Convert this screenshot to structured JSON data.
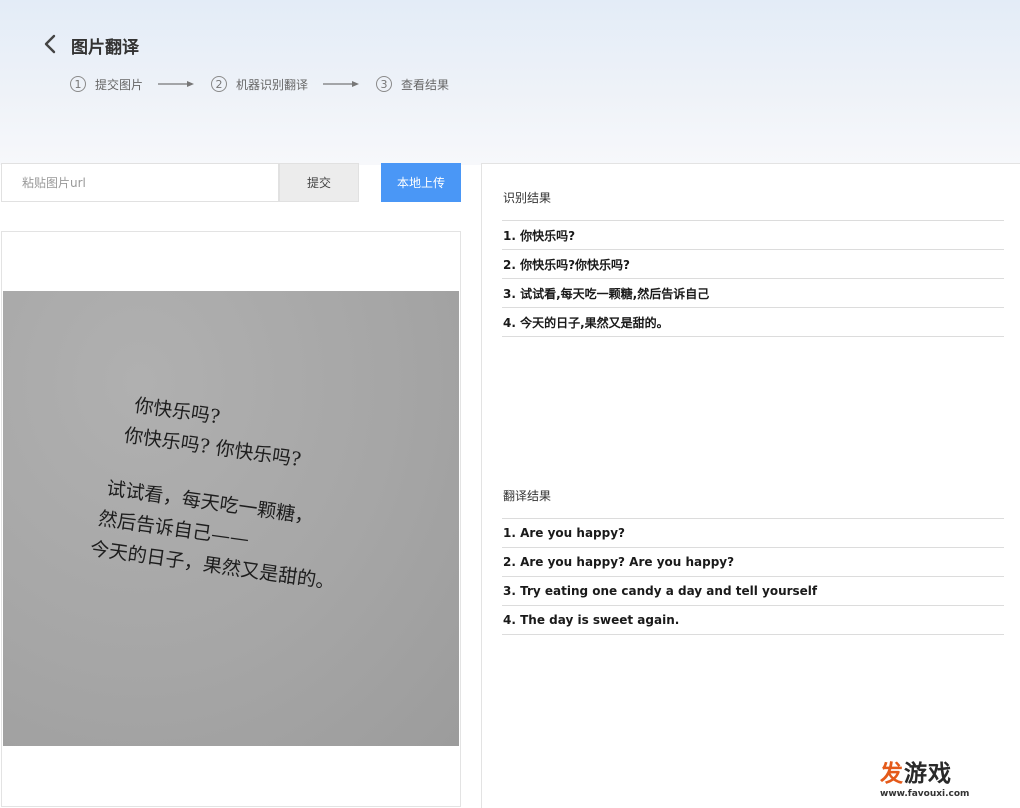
{
  "header": {
    "title": "图片翻译",
    "steps": [
      {
        "num": "1",
        "label": "提交图片"
      },
      {
        "num": "2",
        "label": "机器识别翻译"
      },
      {
        "num": "3",
        "label": "查看结果"
      }
    ]
  },
  "toolbar": {
    "url_placeholder": "粘贴图片url",
    "url_value": "",
    "submit_label": "提交",
    "upload_label": "本地上传"
  },
  "preview": {
    "lines": [
      "你快乐吗?",
      "你快乐吗? 你快乐吗?",
      "试试看，每天吃一颗糖，",
      "然后告诉自己——",
      "今天的日子，果然又是甜的。"
    ]
  },
  "recognition": {
    "title": "识别结果",
    "items": [
      "1. 你快乐吗?",
      "2. 你快乐吗?你快乐吗?",
      "3. 试试看,每天吃一颗糖,然后告诉自己",
      "4. 今天的日子,果然又是甜的。"
    ]
  },
  "translation": {
    "title": "翻译结果",
    "items": [
      "1. Are you happy?",
      "2. Are you happy? Are you happy?",
      "3. Try eating one candy a day and tell yourself",
      "4. The day is sweet again."
    ]
  },
  "watermark": {
    "logo_accent": "发",
    "logo_rest": "游戏",
    "url": "www.favouxi.com"
  }
}
